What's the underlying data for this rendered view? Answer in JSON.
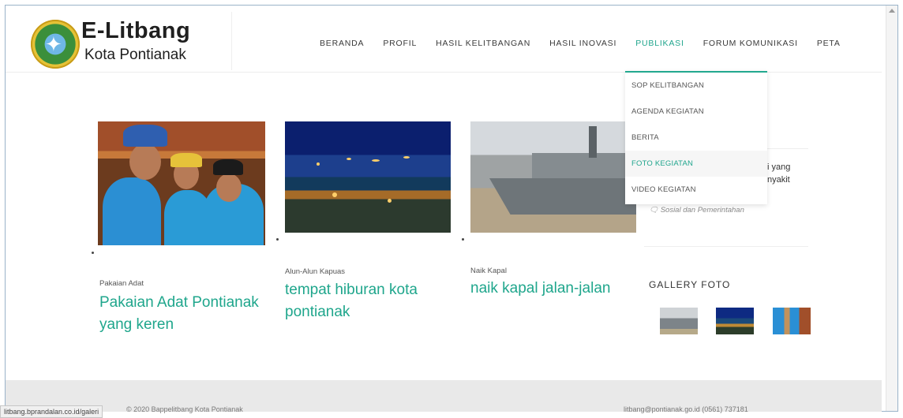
{
  "brand": {
    "name": "E-Litbang",
    "subtitle": "Kota Pontianak"
  },
  "nav": {
    "items": [
      {
        "label": "BERANDA"
      },
      {
        "label": "PROFIL"
      },
      {
        "label": "HASIL KELITBANGAN"
      },
      {
        "label": "HASIL INOVASI"
      },
      {
        "label": "PUBLIKASI"
      },
      {
        "label": "FORUM KOMUNIKASI"
      },
      {
        "label": "PETA"
      }
    ],
    "active": "PUBLIKASI"
  },
  "dropdown": {
    "items": [
      {
        "label": "SOP KELITBANGAN"
      },
      {
        "label": "AGENDA KEGIATAN"
      },
      {
        "label": "BERITA"
      },
      {
        "label": "FOTO KEGIATAN"
      },
      {
        "label": "VIDEO KEGIATAN"
      }
    ],
    "active": "FOTO KEGIATAN"
  },
  "posts": [
    {
      "category": "Pakaian Adat",
      "title": "Pakaian Adat Pontianak yang keren"
    },
    {
      "category": "Alun-Alun Kapuas",
      "title": "tempat hiburan kota pontianak"
    },
    {
      "category": "Naik Kapal",
      "title": "naik kapal jalan-jalan"
    }
  ],
  "side": {
    "text_line1": "i yang",
    "text_line2": "nyakit",
    "meta": "Sosial dan Pemerintahan"
  },
  "gallery": {
    "title": "GALLERY FOTO"
  },
  "footer": {
    "copyright": "© 2020 Bappelitbang Kota Pontianak",
    "contact": "litbang@pontianak.go.id   (0561) 737181"
  },
  "status_url": "litbang.bprandalan.co.id/galeri",
  "colors": {
    "accent": "#20a58d",
    "text": "#333333"
  }
}
